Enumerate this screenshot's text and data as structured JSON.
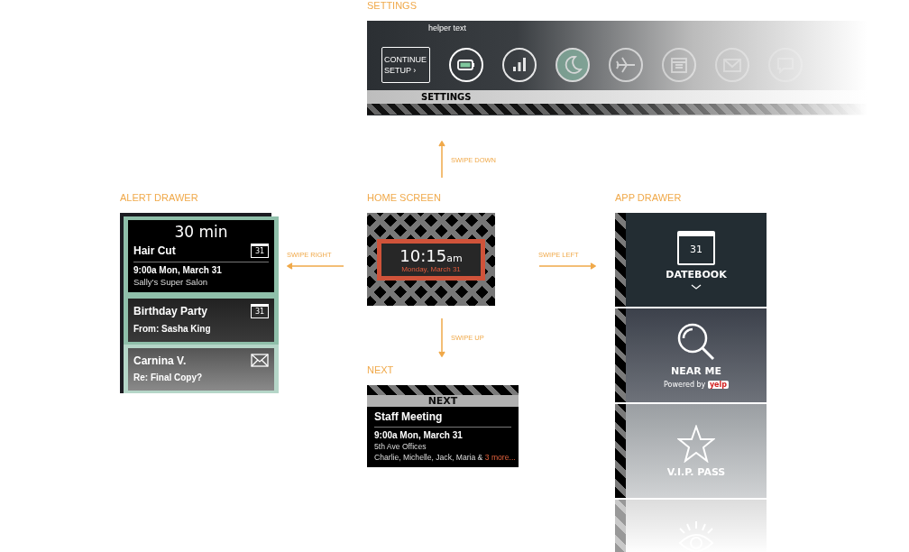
{
  "settings": {
    "label": "SETTINGS",
    "helper": "helper text",
    "continue_button": "CONTINUE SETUP ›",
    "footer": "SETTINGS",
    "toggles": [
      {
        "kind": "battery",
        "selected": false
      },
      {
        "kind": "signal",
        "selected": false
      },
      {
        "kind": "moon",
        "selected": true
      },
      {
        "kind": "airplane",
        "selected": false
      },
      {
        "kind": "calendar",
        "selected": false
      },
      {
        "kind": "mail",
        "selected": false
      },
      {
        "kind": "chat",
        "selected": false
      }
    ]
  },
  "gestures": [
    {
      "kind": "down",
      "label": "SWIPE DOWN"
    },
    {
      "kind": "right",
      "label": "SWIPE RIGHT"
    },
    {
      "kind": "left",
      "label": "SWIPE LEFT"
    },
    {
      "kind": "up",
      "label": "SWIPE UP"
    }
  ],
  "alert_drawer": {
    "label": "ALERT DRAWER",
    "countdown": "30 min",
    "alerts": [
      {
        "kind": "calendar",
        "title": "Hair Cut",
        "date": "31",
        "time": "9:00a Mon, March 31",
        "place": "Sally's Super Salon"
      },
      {
        "kind": "calendar",
        "title": "Birthday Party",
        "date": "31",
        "from": "From: Sasha King"
      },
      {
        "kind": "mail",
        "title": "Carnina V.",
        "from": "Re: Final Copy?"
      }
    ]
  },
  "home_screen": {
    "label": "HOME SCREEN",
    "time": "10:15",
    "suffix": "am",
    "date": "Monday, March 31"
  },
  "next": {
    "label": "NEXT",
    "tag": "NEXT",
    "title": "Staff Meeting",
    "time": "9:00a Mon, March 31",
    "place": "5th Ave Offices",
    "attendees": "Charlie, Michelle, Jack, Maria &",
    "more": "3 more..."
  },
  "app_drawer": {
    "label": "APP DRAWER",
    "apps": [
      {
        "kind": "calendar",
        "date": "31",
        "name": "DATEBOOK",
        "expandable": true
      },
      {
        "kind": "search",
        "name": "NEAR ME",
        "powered": "Powered by",
        "logo": "yelp"
      },
      {
        "kind": "star",
        "name": "V.I.P. PASS"
      },
      {
        "kind": "eye"
      }
    ]
  }
}
